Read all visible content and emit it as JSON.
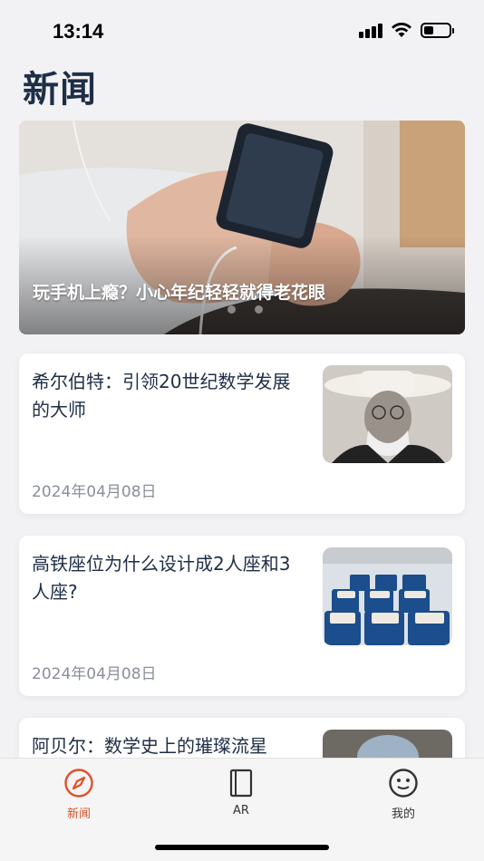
{
  "status_bar": {
    "time": "13:14",
    "icons": [
      "signal-icon",
      "wifi-icon",
      "battery-icon"
    ],
    "battery_level": 0.4
  },
  "page": {
    "title": "新闻"
  },
  "banner": {
    "caption": "玩手机上瘾？小心年纪轻轻就得老花眼",
    "page_count": 3,
    "active_index": 1
  },
  "articles": [
    {
      "title": "希尔伯特：引领20世纪数学发展的大师",
      "date": "2024年04月08日",
      "thumbnail": "portrait-photo"
    },
    {
      "title": "高铁座位为什么设计成2人座和3人座?",
      "date": "2024年04月08日",
      "thumbnail": "train-seats-photo"
    },
    {
      "title": "阿贝尔：数学史上的璀璨流星",
      "date": "",
      "thumbnail": "portrait-photo"
    }
  ],
  "tab_bar": {
    "tabs": [
      {
        "label": "新闻",
        "icon": "compass-icon",
        "active": true
      },
      {
        "label": "AR",
        "icon": "book-icon",
        "active": false
      },
      {
        "label": "我的",
        "icon": "smiley-icon",
        "active": false
      }
    ],
    "accent_color": "#e0502a"
  }
}
